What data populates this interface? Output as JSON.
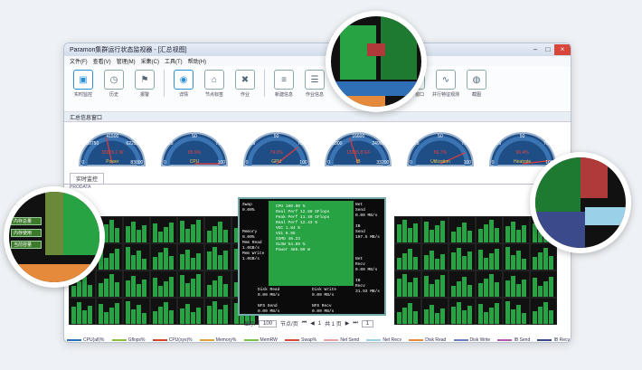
{
  "window": {
    "title": "Paramon集群运行状态监视器 - [汇总视图]"
  },
  "menu": [
    {
      "label": "文件(F)"
    },
    {
      "label": "查看(V)"
    },
    {
      "label": "管理(M)"
    },
    {
      "label": "采集(C)"
    },
    {
      "label": "工具(T)"
    },
    {
      "label": "帮助(H)"
    }
  ],
  "toolbar": [
    {
      "label": "实时监控",
      "icon": "monitor-icon",
      "glyph": "▣",
      "active": true
    },
    {
      "label": "历史",
      "icon": "history-icon",
      "glyph": "◷"
    },
    {
      "label": "报警",
      "icon": "alarm-icon",
      "glyph": "⚑"
    },
    {
      "label": "详情",
      "icon": "eye-icon",
      "glyph": "◉",
      "active": true
    },
    {
      "label": "节点标签",
      "icon": "tag-icon",
      "glyph": "⌂"
    },
    {
      "label": "作业",
      "icon": "job-icon",
      "glyph": "✖"
    },
    {
      "label": "新建信息",
      "icon": "new-info-icon",
      "glyph": "≡"
    },
    {
      "label": "作业信息",
      "icon": "job-info-icon",
      "glyph": "☰"
    },
    {
      "label": "状",
      "icon": "status-icon",
      "glyph": "▤"
    },
    {
      "label": "汇总信息",
      "icon": "summary-icon",
      "glyph": "◎",
      "active": true
    },
    {
      "label": "事件窗口",
      "icon": "event-icon",
      "glyph": "▭"
    },
    {
      "label": "并行特征观测",
      "icon": "feature-icon",
      "glyph": "∿"
    },
    {
      "label": "截图",
      "icon": "camera-icon",
      "glyph": "◍"
    }
  ],
  "panel": {
    "title": "汇总信息窗口"
  },
  "gauges": [
    {
      "top": "41500",
      "mid_l": "20750",
      "mid_r": "62250",
      "center": "35955.2 W",
      "low": "0",
      "high": "83000",
      "name": "Power",
      "value": 0.43
    },
    {
      "top": "50",
      "mid_l": "25",
      "mid_r": "75",
      "center": "99.9%",
      "low": "0",
      "high": "100",
      "name": "CPU",
      "value": 0.999
    },
    {
      "top": "50",
      "mid_l": "25",
      "mid_r": "75",
      "center": "79.0%",
      "low": "0",
      "high": "100",
      "name": "GPU",
      "value": 0.79
    },
    {
      "top": "16600",
      "mid_l": "8300",
      "mid_r": "24900",
      "center": "13255.8 GF",
      "low": "0",
      "high": "33200",
      "name": "IB",
      "value": 0.4
    },
    {
      "top": "50",
      "mid_l": "25",
      "mid_r": "75",
      "center": "86.7%",
      "low": "0",
      "high": "100",
      "name": "Utilization",
      "value": 0.867
    },
    {
      "top": "50",
      "mid_l": "25",
      "mid_r": "75",
      "center": "96.4%",
      "low": "0",
      "high": "100",
      "name": "Heatrate",
      "value": 0.964
    }
  ],
  "tabs": [
    {
      "label": "实时监控"
    }
  ],
  "sublabel": "PRODATA",
  "popup": {
    "left_lines": "Swap\n0.00%\n\n\n\nMemory\n0.00%\nMem Read\n1.0GB/s\nMem Write\n1.0GB/s",
    "center_lines": "CPU 100.00 %\nReal Perf 12.89 GFlops\nPeak Perf 11.40 GFlops\nReal Perf 12.43 %\nVEC 1.84 %\nVU1 0.85\nSIMD 40.23\nSLOW 54.89 %\nPower 486.09 W",
    "right_lines": "Net\nSend\n0.00 MB/s\n\nIB\nSend\n107.5 MB/s\n\n\n\nNet\nRecv\n0.00 MB/s\n\nIB\nRecv\n31.93 MB/s",
    "bottom_lines": "Disk Read\n0.00 MB/s\n\nNFS Send\n0.00 MB/s",
    "bottom_lines2": "Disk Write\n0.00 MB/s\n\nNFS Recv\n0.00 MB/s"
  },
  "pager": {
    "show_label": "显示",
    "page_size": "100",
    "per_page": "节点/页",
    "page_text": "共 1 页",
    "page_no": "1",
    "page_select": "1"
  },
  "legend": [
    {
      "label": "CPU(all)%",
      "color": "#2f6fb5"
    },
    {
      "label": "Gflops%",
      "color": "#8fbf3f"
    },
    {
      "label": "CPU(sys)%",
      "color": "#d0432d"
    },
    {
      "label": "Memory%",
      "color": "#e0a238"
    },
    {
      "label": "MemRW",
      "color": "#7ac04a"
    },
    {
      "label": "Swap%",
      "color": "#d64a3a"
    },
    {
      "label": "Net Send",
      "color": "#e7a0a0"
    },
    {
      "label": "Net Recv",
      "color": "#9ad0e8"
    },
    {
      "label": "Disk Read",
      "color": "#e58a3a"
    },
    {
      "label": "Disk Write",
      "color": "#6a7fc0"
    },
    {
      "label": "IB Send",
      "color": "#b05ab0"
    },
    {
      "label": "IB Recv",
      "color": "#3a4a8a"
    }
  ],
  "zoom_left": [
    "内存总量",
    "内存使用",
    "当前容量"
  ]
}
